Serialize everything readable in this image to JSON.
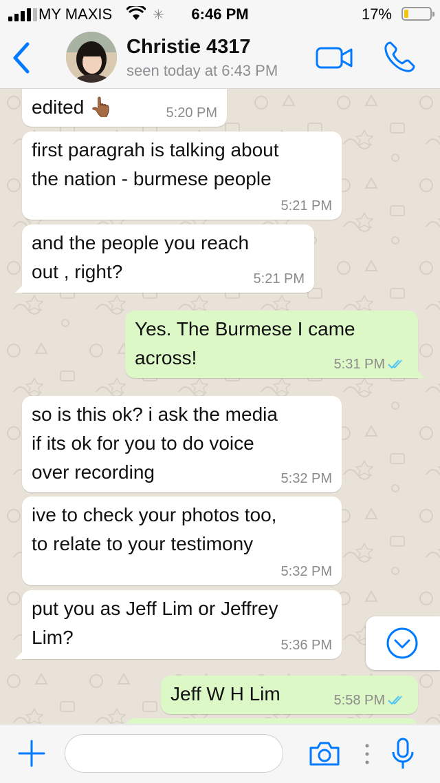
{
  "status_bar": {
    "carrier": "MY MAXIS",
    "time": "6:46 PM",
    "battery_percent": "17%",
    "battery_level": 0.17,
    "icons": [
      "signal-icon",
      "wifi-icon",
      "activity-spinner-icon",
      "battery-icon"
    ]
  },
  "header": {
    "contact_name": "Christie 4317",
    "contact_status": "seen today at 6:43 PM",
    "icons": [
      "back-chevron-icon",
      "avatar",
      "video-call-icon",
      "phone-call-icon"
    ]
  },
  "messages": [
    {
      "direction": "in",
      "text": "edited 👆🏾",
      "time": "5:20 PM"
    },
    {
      "direction": "in",
      "text": "first paragrah is talking about\nthe nation - burmese people",
      "time": "5:21 PM"
    },
    {
      "direction": "in",
      "text": "and the people you reach\nout , right?",
      "time": "5:21 PM"
    },
    {
      "direction": "out",
      "text": "Yes.  The Burmese I came\nacross!",
      "time": "5:31 PM",
      "read": true
    },
    {
      "direction": "in",
      "text": "so is this ok? i ask the media\nif its ok for you to do voice\nover recording",
      "time": "5:32 PM"
    },
    {
      "direction": "in",
      "text": "ive to check your photos too,\nto relate to your testimony",
      "time": "5:32 PM"
    },
    {
      "direction": "in",
      "text": "put you as Jeff Lim or Jeffrey\nLim?",
      "time": "5:36 PM"
    },
    {
      "direction": "out",
      "text": "Jeff W H Lim",
      "time": "5:58 PM",
      "read": true
    }
  ],
  "input_bar": {
    "placeholder": "",
    "icons": [
      "plus-icon",
      "camera-icon",
      "more-dots-icon",
      "microphone-icon"
    ]
  },
  "colors": {
    "accent": "#007aff",
    "incoming_bubble": "#ffffff",
    "outgoing_bubble": "#dcf8c6",
    "read_ticks": "#4fc3f7",
    "chat_background": "#e8e2d8"
  }
}
